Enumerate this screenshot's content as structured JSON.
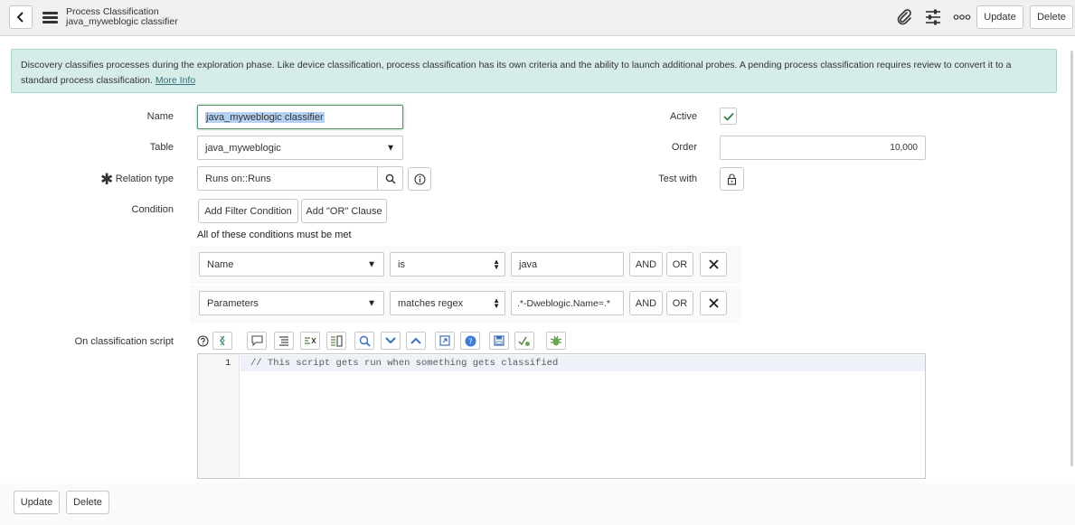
{
  "header": {
    "back_icon": "chevron-left-icon",
    "menu_icon": "hamburger-menu-icon",
    "title": "Process Classification",
    "subtitle": "java_myweblogic classifier",
    "attachment_icon": "paperclip-icon",
    "settings_icon": "sliders-icon",
    "more_icon": "more-options-icon",
    "update_label": "Update",
    "delete_label": "Delete"
  },
  "banner": {
    "text": "Discovery classifies processes during the exploration phase. Like device classification, process classification has its own criteria and the ability to launch additional probes. A pending process classification requires review to convert it to a standard process classification.",
    "link": "More Info",
    "color": "#d6ece9"
  },
  "form": {
    "name_label": "Name",
    "name_value": "java_myweblogic classifier",
    "table_label": "Table",
    "table_value": "java_myweblogic",
    "relation_label": "Relation type",
    "relation_value": "Runs on::Runs",
    "condition_label": "Condition",
    "add_filter_label": "Add Filter Condition",
    "add_or_label": "Add \"OR\" Clause",
    "conditions_heading": "All of these conditions must be met",
    "active_label": "Active",
    "active_checked": true,
    "order_label": "Order",
    "order_value": "10,000",
    "test_with_label": "Test with"
  },
  "conditions": [
    {
      "field": "Name",
      "operator": "is",
      "value": "java",
      "and_label": "AND",
      "or_label": "OR"
    },
    {
      "field": "Parameters",
      "operator": "matches regex",
      "value": ".*-Dweblogic.Name=.*",
      "and_label": "AND",
      "or_label": "OR"
    }
  ],
  "script": {
    "label": "On classification script",
    "toolbar_icons": [
      "help-icon",
      "toggle-syntax-icon",
      "comment-icon",
      "format-icon",
      "replace-icon",
      "replace-all-icon",
      "search-icon",
      "collapse-icon",
      "expand-icon",
      "fullscreen-icon",
      "script-help-icon",
      "save-icon",
      "syntax-check-icon",
      "debug-icon"
    ],
    "line_number": "1",
    "code": "// This script gets run when something gets classified"
  },
  "footer": {
    "update_label": "Update",
    "delete_label": "Delete"
  },
  "colors": {
    "accent_green": "#2e8540",
    "focus_border": "#5a8f70"
  }
}
